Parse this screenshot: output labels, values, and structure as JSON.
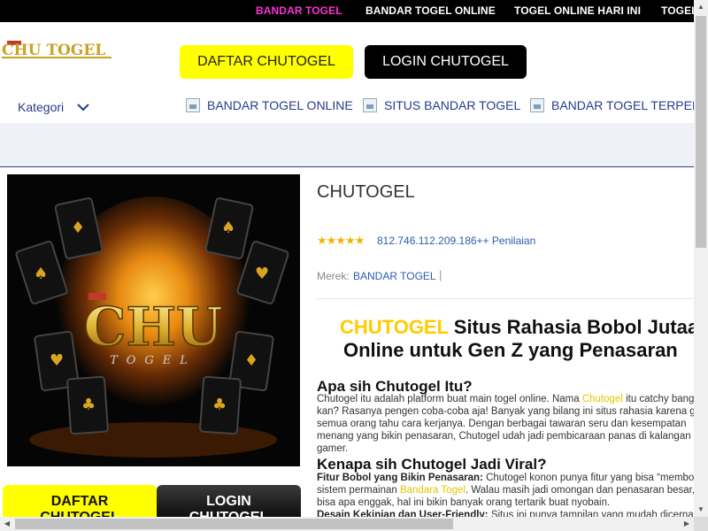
{
  "topbar": {
    "links": [
      "BANDAR TOGEL",
      "BANDAR TOGEL ONLINE",
      "TOGEL ONLINE HARI INI",
      "TOGEL"
    ]
  },
  "header": {
    "logo_text": "CHU TOGEL",
    "daftar_label": "DAFTAR CHUTOGEL",
    "login_label": "LOGIN CHUTOGEL"
  },
  "nav": {
    "kategori_label": "Kategori",
    "links": [
      "BANDAR TOGEL ONLINE",
      "SITUS BANDAR TOGEL",
      "BANDAR TOGEL TERPERCAYA"
    ]
  },
  "product": {
    "image_logo_text": "CHU",
    "image_logo_sub": "TOGEL",
    "title": "CHUTOGEL",
    "stars": "★★★★★",
    "rating_text": "812.746.112.209.186++ Penilaian",
    "merek_label": "Merek:",
    "merek_value": "BANDAR TOGEL",
    "merek_sep": "|"
  },
  "article": {
    "headline_highlight": "CHUTOGEL",
    "headline_rest": " Situs Rahasia Bobol Jutaan",
    "headline_line2": "Online untuk Gen Z yang Penasaran",
    "section1_title": "Apa sih Chutogel Itu?",
    "s1_l1_a": "Chutogel itu adalah platform buat main togel online. Nama ",
    "s1_l1_hl": "Chutogel",
    "s1_l1_b": " itu catchy banget",
    "s1_l2": "kan? Rasanya pengen coba-coba aja! Banyak yang bilang ini situs rahasia karena gak",
    "s1_l3": "semua orang tahu cara kerjanya. Dengan berbagai tawaran seru dan kesempatan",
    "s1_l4": "menang yang bikin penasaran, Chutogel udah jadi pembicaraan panas di kalangan",
    "s1_l5": "gamer.",
    "section2_title": "Kenapa sih Chutogel Jadi Viral?",
    "s2_l1_bold": "Fitur Bobol yang Bikin Penasaran:",
    "s2_l1_rest": " Chutogel konon punya fitur yang bisa “membobol”",
    "s2_l2_a": "sistem permainan ",
    "s2_l2_hl": "Bandara Togel",
    "s2_l2_b": ". Walau masih jadi omongan dan penasaran besar,",
    "s2_l3": "bisa apa enggak, hal ini bikin banyak orang tertarik buat nyobain.",
    "s2_l4_bold": "Desain Kekinian dan User-Friendly:",
    "s2_l4_rest": " Situs ini punya tampilan yang mudah dicerna"
  },
  "bottom_buttons": {
    "daftar_l1": "DAFTAR",
    "daftar_l2": "CHUTOGEL",
    "login_l1": "LOGIN",
    "login_l2": "CHUTOGEL"
  },
  "colors": {
    "accent_yellow": "#ffff00",
    "topbar_active": "#ff2fd6",
    "link_blue": "#283a8c",
    "headline_yellow": "#ffcc00"
  }
}
